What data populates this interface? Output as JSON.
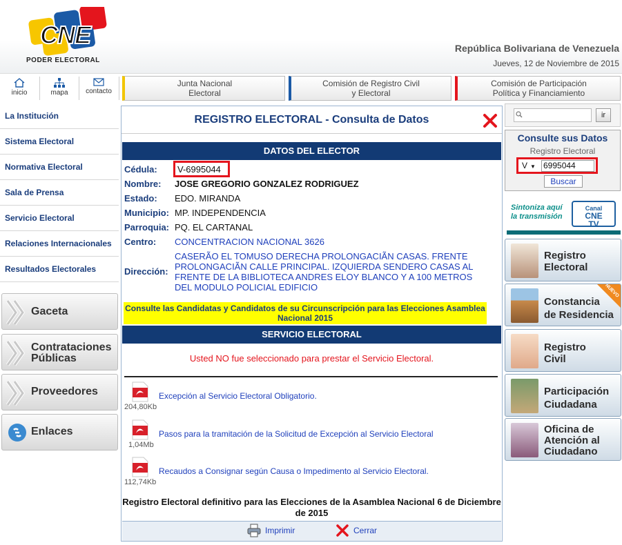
{
  "header": {
    "logo_text": "CNE",
    "logo_subtitle": "PODER ELECTORAL",
    "republic": "República Bolivariana de Venezuela",
    "date": "Jueves, 12 de Noviembre de 2015"
  },
  "topnav": {
    "icons": [
      {
        "label": "inicio",
        "icon": "home-icon"
      },
      {
        "label": "mapa",
        "icon": "sitemap-icon"
      },
      {
        "label": "contacto",
        "icon": "envelope-icon"
      }
    ],
    "buttons": [
      {
        "line1": "Junta Nacional",
        "line2": "Electoral",
        "color": "#f2c500"
      },
      {
        "line1": "Comisión de Registro Civil",
        "line2": "y Electoral",
        "color": "#1b5aa6"
      },
      {
        "line1": "Comisión de Participación",
        "line2": "Política y Financiamiento",
        "color": "#e4151d"
      }
    ]
  },
  "leftnav": {
    "items": [
      "La Institución",
      "Sistema Electoral",
      "Normativa Electoral",
      "Sala de Prensa",
      "Servicio Electoral",
      "Relaciones Internacionales",
      "Resultados Electorales"
    ],
    "buttons": [
      {
        "line1": "Gaceta",
        "line2": ""
      },
      {
        "line1": "Contrataciones",
        "line2": "Públicas"
      },
      {
        "line1": "Proveedores",
        "line2": ""
      },
      {
        "line1": "Enlaces",
        "line2": ""
      }
    ]
  },
  "main": {
    "title": "REGISTRO ELECTORAL - Consulta de Datos",
    "section_elector": "DATOS DEL ELECTOR",
    "fields": [
      {
        "label": "Cédula:",
        "value": "V-6995044"
      },
      {
        "label": "Nombre:",
        "value": "JOSE GREGORIO GONZALEZ RODRIGUEZ"
      },
      {
        "label": "Estado:",
        "value": "EDO. MIRANDA"
      },
      {
        "label": "Municipio:",
        "value": "MP. INDEPENDENCIA"
      },
      {
        "label": "Parroquia:",
        "value": "PQ. EL CARTANAL"
      },
      {
        "label": "Centro:",
        "value": "CONCENTRACION NACIONAL 3626"
      },
      {
        "label": "Dirección:",
        "value": "CASERÃO EL TOMUSO DERECHA PROLONGACIÃN CASAS. FRENTE PROLONGACIÃN CALLE PRINCIPAL. IZQUIERDA SENDERO CASAS AL FRENTE DE LA BIBLIOTECA ANDRES ELOY BLANCO Y A 100 METROS DEL MODULO POLICIAL EDIFICIO"
      }
    ],
    "candidates_notice": "Consulte las Candidatas y Candidatos de su Circunscripción para las Elecciones Asamblea Nacional 2015",
    "section_service": "SERVICIO ELECTORAL",
    "not_selected": "Usted NO fue seleccionado para prestar el Servicio Electoral.",
    "documents": [
      {
        "title": "Excepción al Servicio Electoral Obligatorio.",
        "size": "204,80Kb"
      },
      {
        "title": "Pasos para la tramitación de la Solicitud de Excepción al Servicio Electoral",
        "size": "1,04Mb"
      },
      {
        "title": "Recaudos a Consignar según Causa o Impedimento al Servicio Electoral.",
        "size": "112,74Kb"
      }
    ],
    "final_note": "Registro Electoral definitivo para las Elecciones de la Asamblea Nacional 6 de Diciembre de 2015",
    "print_label": "Imprimir",
    "close_label": "Cerrar"
  },
  "rightbar": {
    "search_button": "ir",
    "consult_title": "Consulte sus Datos",
    "consult_subtitle": "Registro Electoral",
    "nationality": "V",
    "cedula_value": "6995044",
    "buscar": "Buscar",
    "tv_text1": "Sintoniza aquí",
    "tv_text2": "la transmisión",
    "tv_logo1": "Canal",
    "tv_logo2": "CNE",
    "tv_logo3": "TV",
    "badge_new": "NUEVO",
    "buttons": [
      {
        "line1": "Registro",
        "line2": "Electoral",
        "line3": ""
      },
      {
        "line1": "Constancia",
        "line2": "de Residencia",
        "line3": ""
      },
      {
        "line1": "Registro",
        "line2": "Civil",
        "line3": ""
      },
      {
        "line1": "Participación",
        "line2": "Ciudadana",
        "line3": ""
      },
      {
        "line1": "Oficina de",
        "line2": "Atención al",
        "line3": "Ciudadano"
      }
    ]
  }
}
